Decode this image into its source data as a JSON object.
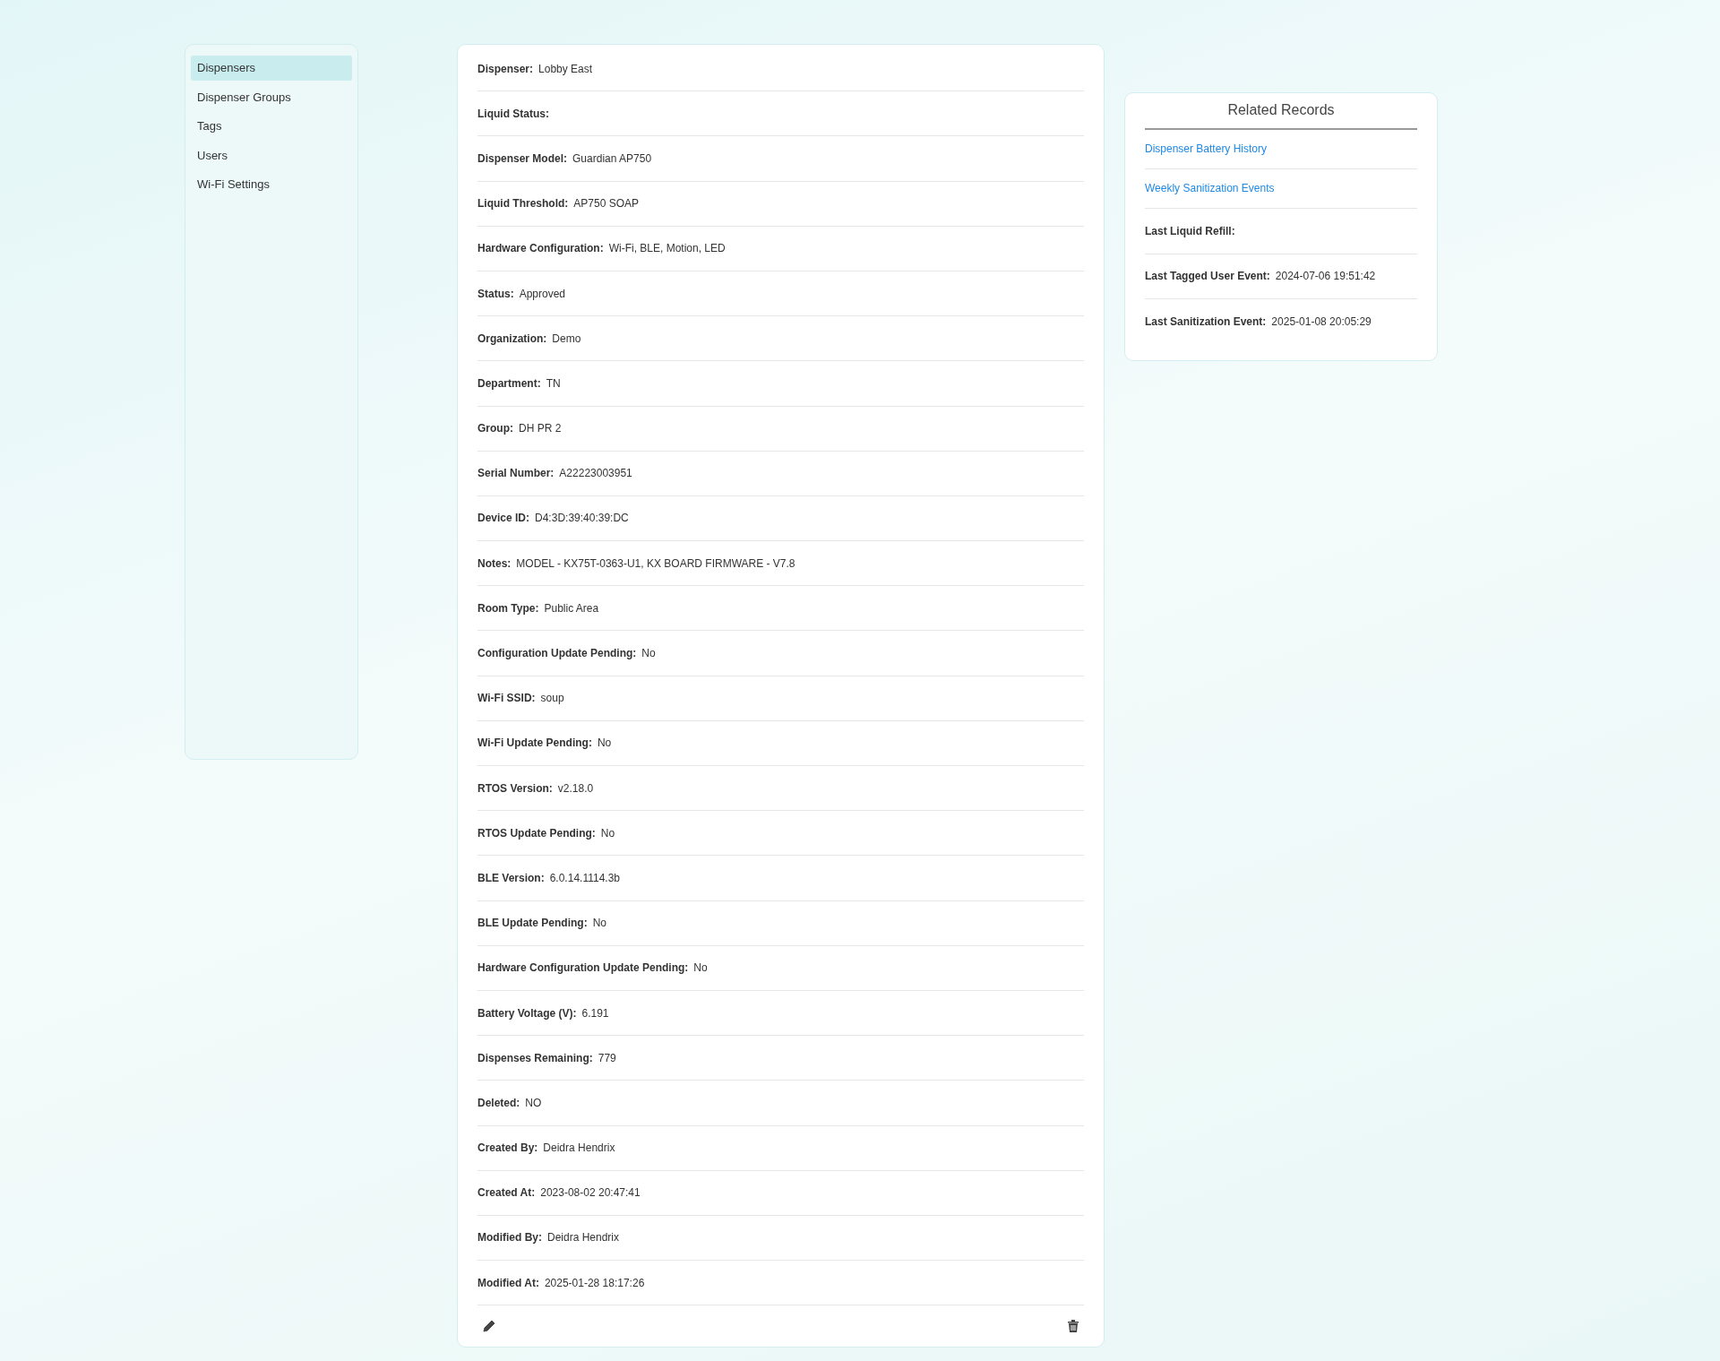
{
  "sidebar": {
    "items": [
      {
        "label": "Dispensers",
        "selected": true
      },
      {
        "label": "Dispenser Groups",
        "selected": false
      },
      {
        "label": "Tags",
        "selected": false
      },
      {
        "label": "Users",
        "selected": false
      },
      {
        "label": "Wi-Fi Settings",
        "selected": false
      }
    ]
  },
  "details": {
    "fields": [
      {
        "label": "Dispenser:",
        "value": "Lobby East"
      },
      {
        "label": "Liquid Status:"
      },
      {
        "label": "Dispenser Model:",
        "value": "Guardian AP750"
      },
      {
        "label": "Liquid Threshold:",
        "value": "AP750 SOAP"
      },
      {
        "label": "Hardware Configuration:",
        "value": "Wi-Fi, BLE, Motion, LED"
      },
      {
        "label": "Status:",
        "value": "Approved"
      },
      {
        "label": "Organization:",
        "value": "Demo"
      },
      {
        "label": "Department:",
        "value": "TN"
      },
      {
        "label": "Group:",
        "value": "DH PR 2"
      },
      {
        "label": "Serial Number:",
        "value": "A22223003951"
      },
      {
        "label": "Device ID:",
        "value": "D4:3D:39:40:39:DC"
      },
      {
        "label": "Notes:",
        "value": "MODEL - KX75T-0363-U1, KX BOARD FIRMWARE - V7.8"
      },
      {
        "label": "Room Type:",
        "value": "Public Area"
      },
      {
        "label": "Configuration Update Pending:",
        "value": "No"
      },
      {
        "label": "Wi-Fi SSID:",
        "value": "soup"
      },
      {
        "label": "Wi-Fi Update Pending:",
        "value": "No"
      },
      {
        "label": "RTOS Version:",
        "value": "v2.18.0"
      },
      {
        "label": "RTOS Update Pending:",
        "value": "No"
      },
      {
        "label": "BLE Version:",
        "value": "6.0.14.1114.3b"
      },
      {
        "label": "BLE Update Pending:",
        "value": "No"
      },
      {
        "label": "Hardware Configuration Update Pending:",
        "value": "No"
      },
      {
        "label": "Battery Voltage (V):",
        "value": "6.191"
      },
      {
        "label": "Dispenses Remaining:",
        "value": "779"
      },
      {
        "label": "Deleted:",
        "value": "NO"
      },
      {
        "label": "Created By:",
        "value": "Deidra Hendrix"
      },
      {
        "label": "Created At:",
        "value": "2023-08-02 20:47:41"
      },
      {
        "label": "Modified By:",
        "value": "Deidra Hendrix"
      },
      {
        "label": "Modified At:",
        "value": "2025-01-28 18:17:26"
      }
    ]
  },
  "related_records": {
    "title": "Related Records",
    "links": [
      "Dispenser Battery History",
      "Weekly Sanitization Events"
    ],
    "fields": [
      {
        "label": "Last Liquid Refill:"
      },
      {
        "label": "Last Tagged User Event:",
        "value": "2024-07-06 19:51:42"
      },
      {
        "label": "Last Sanitization Event:",
        "value": "2025-01-08 20:05:29"
      }
    ]
  }
}
